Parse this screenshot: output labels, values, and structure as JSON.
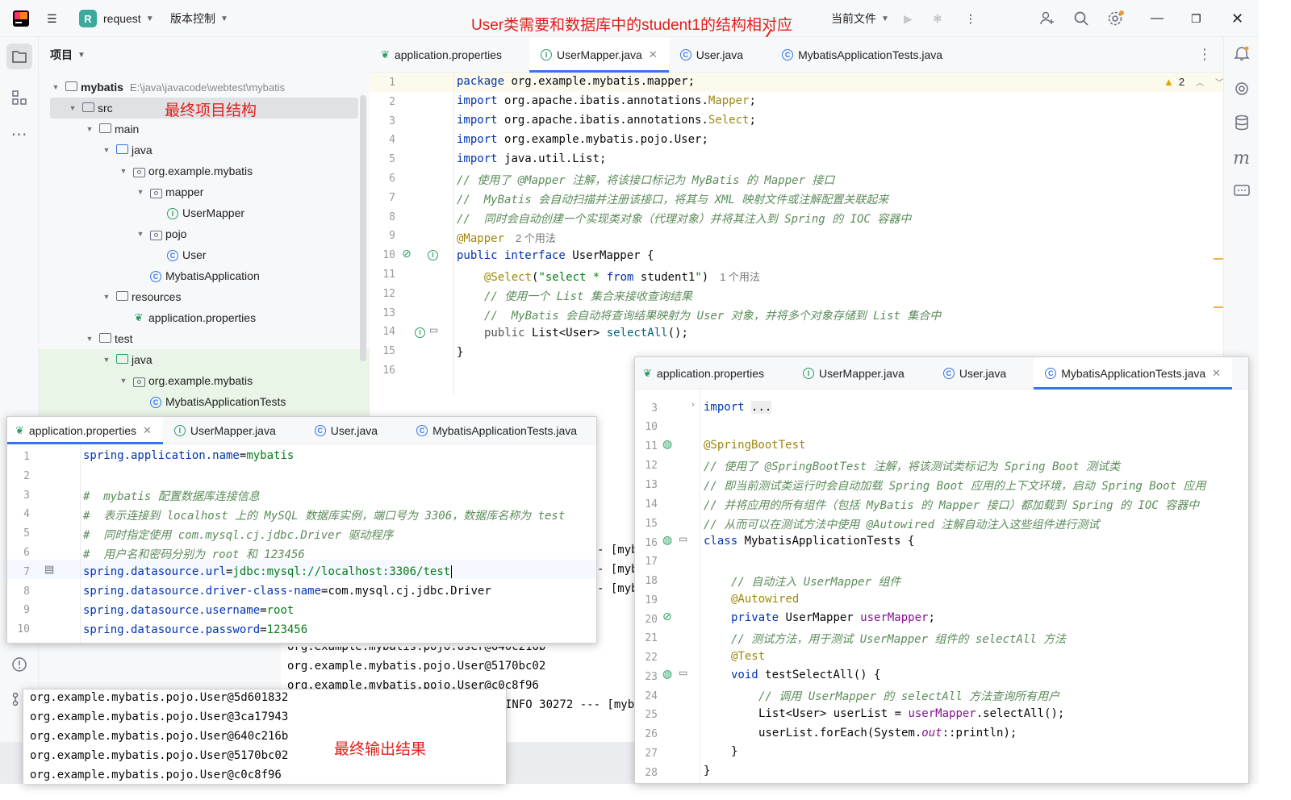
{
  "titlebar": {
    "project_badge": "R",
    "project_name": "request",
    "vcs_label": "版本控制",
    "run_config": "当前文件",
    "annotation_top": "User类需要和数据库中的student1的结构相对应"
  },
  "project_panel": {
    "title": "项目",
    "annotation": "最终项目结构",
    "root_name": "mybatis",
    "root_path": "E:\\java\\javacode\\webtest\\mybatis",
    "tree": [
      {
        "label": "src",
        "depth": 1,
        "icon": "folder-icon",
        "expanded": true
      },
      {
        "label": "main",
        "depth": 2,
        "icon": "folder-icon",
        "expanded": true
      },
      {
        "label": "java",
        "depth": 3,
        "icon": "folder-blue-icon",
        "expanded": true
      },
      {
        "label": "org.example.mybatis",
        "depth": 4,
        "icon": "package-icon",
        "expanded": true
      },
      {
        "label": "mapper",
        "depth": 5,
        "icon": "package-icon",
        "expanded": true
      },
      {
        "label": "UserMapper",
        "depth": 6,
        "icon": "interface-icon"
      },
      {
        "label": "pojo",
        "depth": 5,
        "icon": "package-icon",
        "expanded": true
      },
      {
        "label": "User",
        "depth": 6,
        "icon": "class-icon"
      },
      {
        "label": "MybatisApplication",
        "depth": 5,
        "icon": "spring-class-icon"
      },
      {
        "label": "resources",
        "depth": 3,
        "icon": "folder-icon",
        "expanded": true
      },
      {
        "label": "application.properties",
        "depth": 4,
        "icon": "spring-properties-icon"
      },
      {
        "label": "test",
        "depth": 2,
        "icon": "folder-icon",
        "expanded": true
      },
      {
        "label": "java",
        "depth": 3,
        "icon": "folder-green-icon",
        "expanded": true
      },
      {
        "label": "org.example.mybatis",
        "depth": 4,
        "icon": "package-icon",
        "expanded": true
      },
      {
        "label": "MybatisApplicationTests",
        "depth": 5,
        "icon": "spring-class-icon"
      }
    ]
  },
  "main_editor": {
    "tabs": [
      "application.properties",
      "UserMapper.java",
      "User.java",
      "MybatisApplicationTests.java"
    ],
    "active_tab": 1,
    "warnings": "2",
    "line_numbers": [
      "1",
      "2",
      "3",
      "4",
      "5",
      "6",
      "7",
      "8",
      "9",
      "10",
      "11",
      "12",
      "13",
      "14",
      "15",
      "16"
    ],
    "usage_hint_mapper": "2 个用法",
    "usage_hint_select": "1 个用法",
    "lines": {
      "l1a": "package ",
      "l1b": "org.example.mybatis.mapper;",
      "l2a": "import ",
      "l2b": "org.apache.ibatis.annotations.",
      "l2c": "Mapper",
      "l2d": ";",
      "l3a": "import ",
      "l3b": "org.apache.ibatis.annotations.",
      "l3c": "Select",
      "l3d": ";",
      "l4a": "import ",
      "l4b": "org.example.mybatis.pojo.User;",
      "l5a": "import ",
      "l5b": "java.util.List;",
      "l6": "// 使用了 @Mapper 注解，将该接口标记为 MyBatis 的 Mapper 接口",
      "l7": "//  MyBatis 会自动扫描并注册该接口，将其与 XML 映射文件或注解配置关联起来",
      "l8": "//  同时会自动创建一个实现类对象（代理对象）并将其注入到 Spring 的 IOC 容器中",
      "l9": "@Mapper",
      "l10a": "public interface ",
      "l10b": "UserMapper {",
      "l11a": "@Select",
      "l11b": "(",
      "l11c": "\"select * ",
      "l11d": "from ",
      "l11e": "student1",
      "l11f": "\"",
      "l11g": ")",
      "l12": "// 使用一个 List 集合来接收查询结果",
      "l13": "//  MyBatis 会自动将查询结果映射为 User 对象，并将多个对象存储到 List 集合中",
      "l14a": "public ",
      "l14b": "List<User> ",
      "l14c": "selectAll",
      "l14d": "();",
      "l15": "}"
    }
  },
  "props_editor": {
    "tabs": [
      "application.properties",
      "UserMapper.java",
      "User.java",
      "MybatisApplicationTests.java"
    ],
    "active_tab": 0,
    "line_numbers": [
      "1",
      "2",
      "3",
      "4",
      "5",
      "6",
      "7",
      "8",
      "9",
      "10"
    ],
    "lines": {
      "p1k": "spring.application.name",
      "p1v": "mybatis",
      "p3": "#  mybatis 配置数据库连接信息",
      "p4": "#  表示连接到 localhost 上的 MySQL 数据库实例，端口号为 3306，数据库名称为 test",
      "p5": "#  同时指定使用 com.mysql.cj.jdbc.Driver 驱动程序",
      "p6": "#  用户名和密码分别为 root 和 123456",
      "p7k": "spring.datasource.url",
      "p7v": "jdbc:mysql://localhost:3306/test",
      "p8k": "spring.datasource.driver-class-name",
      "p8v": "com.mysql.cj.jdbc.Driver",
      "p9k": "spring.datasource.username",
      "p9v": "root",
      "p10k": "spring.datasource.password",
      "p10v": "123456",
      "eq": "="
    }
  },
  "tests_editor": {
    "tabs": [
      "application.properties",
      "UserMapper.java",
      "User.java",
      "MybatisApplicationTests.java"
    ],
    "active_tab": 3,
    "line_numbers": [
      "3",
      "10",
      "11",
      "12",
      "13",
      "14",
      "15",
      "16",
      "17",
      "18",
      "19",
      "20",
      "21",
      "22",
      "23",
      "24",
      "25",
      "26",
      "27",
      "28"
    ],
    "lines": {
      "t3a": "import ",
      "t3b": "...",
      "t11": "@SpringBootTest",
      "t12": "// 使用了 @SpringBootTest 注解，将该测试类标记为 Spring Boot 测试类",
      "t13": "// 即当前测试类运行时会自动加载 Spring Boot 应用的上下文环境，启动 Spring Boot 应用",
      "t14": "// 并将应用的所有组件（包括 MyBatis 的 Mapper 接口）都加载到 Spring 的 IOC 容器中",
      "t15": "// 从而可以在测试方法中使用 @Autowired 注解自动注入这些组件进行测试",
      "t16a": "class ",
      "t16b": "MybatisApplicationTests {",
      "t18": "// 自动注入 UserMapper 组件",
      "t19": "@Autowired",
      "t20a": "private ",
      "t20b": "UserMapper ",
      "t20c": "userMapper",
      "t20d": ";",
      "t21": "// 测试方法，用于测试 UserMapper 组件的 selectAll 方法",
      "t22": "@Test",
      "t23a": "void ",
      "t23b": "testSelectAll() {",
      "t24": "// 调用 UserMapper 的 selectAll 方法查询所有用户",
      "t25a": "List<User> userList = ",
      "t25b": "userMapper",
      "t25c": ".selectAll();",
      "t26a": "userList.forEach(System.",
      "t26b": "out",
      "t26c": "::println);",
      "t27": "}",
      "t28": "}"
    }
  },
  "console_bg": {
    "lines": [
      "org.example.mybatis.pojo.User@640c216b",
      "org.example.mybatis.pojo.User@5170bc02",
      "org.example.mybatis.pojo.User@c0c8f96"
    ],
    "log_fragment": "INFO 30272 --- [myb",
    "side_fragments": [
      "- [myb",
      "- [myb",
      "- [myb"
    ]
  },
  "console_popup": {
    "lines": [
      "org.example.mybatis.pojo.User@5d601832",
      "org.example.mybatis.pojo.User@3ca17943",
      "org.example.mybatis.pojo.User@640c216b",
      "org.example.mybatis.pojo.User@5170bc02",
      "org.example.mybatis.pojo.User@c0c8f96"
    ],
    "annotation": "最终输出结果"
  },
  "colors": {
    "accent": "#3574f0",
    "annotation_red": "#e0201c",
    "keyword": "#0033b3",
    "annotation_code": "#9e880d",
    "string": "#067d17",
    "field": "#871094"
  }
}
